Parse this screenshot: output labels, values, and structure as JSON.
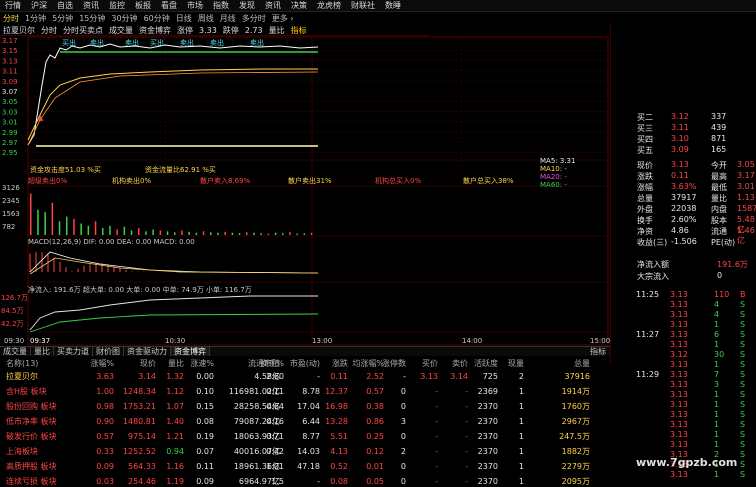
{
  "menu": [
    "行情",
    "沪深",
    "自选",
    "资讯",
    "监控",
    "板报",
    "看盘",
    "市场",
    "指数",
    "发现",
    "资讯",
    "决策",
    "龙虎榜",
    "财联社",
    "数睡"
  ],
  "periods": [
    {
      "label": "分时",
      "active": true
    },
    {
      "label": "1分钟"
    },
    {
      "label": "5分钟"
    },
    {
      "label": "15分钟"
    },
    {
      "label": "30分钟"
    },
    {
      "label": "60分钟"
    },
    {
      "label": "日线"
    },
    {
      "label": "周线"
    },
    {
      "label": "月线"
    },
    {
      "label": "多分时"
    },
    {
      "label": "更多 ›"
    }
  ],
  "toolbar": [
    "拉夏贝尔",
    "分时",
    "分时买卖点",
    "成交量",
    "资金博弈",
    "涨停",
    "3.33",
    "跌停",
    "2.73",
    "量比",
    "指标"
  ],
  "chart_labels": {
    "price_ticks": [
      "3.17",
      "3.15",
      "3.13",
      "3.11",
      "3.09",
      "3.07",
      "3.05",
      "3.03",
      "3.01",
      "2.99",
      "2.97",
      "2.95"
    ],
    "pct_ticks": [
      "1.92%",
      "1.27%",
      "0.63%",
      "0.63%",
      "1.27%",
      "1.92%",
      "2.56%",
      "3.21%",
      "3.85%",
      "4.49%",
      "5.13%",
      "5.77%"
    ],
    "buy_signals": [
      "买出",
      "卖出",
      "卖出",
      "买出",
      "卖出",
      "卖出",
      "卖出"
    ],
    "note1": "资金攻击度51.03 %买",
    "note2": "资金流量比62.91 %买",
    "ma5": "MA5: 3.31",
    "ma10": "MA10: -",
    "ma20": "MA20: -",
    "ma60": "MA60: -",
    "lot_row": [
      "超级卖出0%",
      "机构卖出0%",
      "散户卖入8.69%",
      "散户卖出31%",
      "机构总买入0%",
      "散户总买入38%"
    ],
    "vol_ticks": [
      "3126",
      "2345",
      "1563",
      "782"
    ],
    "macd_label": "MACD(12,26,9) DIF: 0.00  DEA: 0.00  MACD: 0.00",
    "macd_ticks": [
      "0.10",
      "0.05",
      "0.00",
      "-0.05",
      "-0.10"
    ],
    "flow_label": "净流入: 191.6万  超大单: 0.00  大单: 0.00  中单: 74.9万  小单: 116.7万",
    "flow_ticks": [
      "126.7万",
      "84.5万",
      "42.2万"
    ],
    "time_ticks": [
      "09:30",
      "09:37",
      "10:30",
      "13:00",
      "14:00",
      "15:00"
    ]
  },
  "quote": {
    "rows": [
      {
        "label": "买二",
        "price": "3.12",
        "vol": "337"
      },
      {
        "label": "买三",
        "price": "3.11",
        "vol": "439"
      },
      {
        "label": "买四",
        "price": "3.10",
        "vol": "871"
      },
      {
        "label": "买五",
        "price": "3.09",
        "vol": "165"
      },
      {
        "label": "现价",
        "price": "3.13",
        "vol": "今开",
        "extra": "3.05"
      },
      {
        "label": "涨跌",
        "price": "0.11",
        "vol": "最高",
        "extra": "3.17"
      },
      {
        "label": "涨幅",
        "price": "3.63%",
        "vol": "最低",
        "extra": "3.01"
      },
      {
        "label": "总量",
        "price": "37917",
        "vol": "量比",
        "extra": "1.13"
      },
      {
        "label": "外盘",
        "price": "22038",
        "vol": "内盘",
        "extra": "15879"
      },
      {
        "label": "换手",
        "price": "2.60%",
        "vol": "股本",
        "extra": "5.48亿"
      },
      {
        "label": "净资",
        "price": "4.86",
        "vol": "流通",
        "extra": "1.46亿"
      },
      {
        "label": "收益(三)",
        "price": "-1.506",
        "vol": "PE(动)",
        "extra": "-"
      }
    ],
    "netflow_label": "净流入额",
    "netflow_value": "191.6万",
    "bigflow_label": "大宗流入",
    "bigflow_value": "0"
  },
  "tabs": [
    "成交量",
    "量比",
    "买卖力道",
    "财价图",
    "资金驱动力",
    "资金博弈"
  ],
  "tabs_right": [
    "指标"
  ],
  "table": {
    "headers": [
      "名称(13)",
      "涨幅%",
      "现价",
      "量比",
      "涨速%",
      "流通市值",
      "换手%",
      "市盈(动)",
      "涨跌",
      "均涨幅%",
      "涨停数",
      "买价",
      "卖价",
      "活跃度",
      "现量",
      "总量"
    ],
    "rows": [
      [
        "拉夏贝尔",
        "3.63",
        "3.14",
        "1.32",
        "0.00",
        "4.58亿",
        "2.60",
        "-",
        "0.11",
        "2.52",
        "-",
        "3.13",
        "3.14",
        "725",
        "2",
        "37916"
      ],
      [
        "含H股 板块",
        "1.00",
        "1248.34",
        "1.12",
        "0.10",
        "116981.02亿",
        "0.11",
        "8.78",
        "12.37",
        "0.57",
        "0",
        "-",
        "-",
        "2369",
        "1",
        "1914万"
      ],
      [
        "股份回购 板块",
        "0.98",
        "1753.21",
        "1.07",
        "0.15",
        "28258.54亿",
        "0.64",
        "17.04",
        "16.98",
        "0.38",
        "0",
        "-",
        "-",
        "2370",
        "1",
        "1760万"
      ],
      [
        "低市净率 板块",
        "0.90",
        "1480.81",
        "1.40",
        "0.08",
        "79087.24亿",
        "0.16",
        "6.44",
        "13.28",
        "0.86",
        "3",
        "-",
        "-",
        "2370",
        "1",
        "2967万"
      ],
      [
        "破发行价 板块",
        "0.57",
        "975.14",
        "1.21",
        "0.19",
        "18063.93亿",
        "0.71",
        "8.77",
        "5.51",
        "0.25",
        "0",
        "-",
        "-",
        "2370",
        "1",
        "247.5万"
      ],
      [
        "上海板块",
        "0.33",
        "1252.52",
        "0.94",
        "0.07",
        "40016.07亿",
        "0.42",
        "14.03",
        "4.13",
        "0.12",
        "2",
        "-",
        "-",
        "2370",
        "1",
        "1882万"
      ],
      [
        "高质押股 板块",
        "0.09",
        "564.33",
        "1.16",
        "0.11",
        "18961.36亿",
        "1.01",
        "47.18",
        "0.52",
        "0.01",
        "0",
        "-",
        "-",
        "2370",
        "1",
        "2279万"
      ],
      [
        "连续亏损 板块",
        "0.03",
        "254.46",
        "1.19",
        "0.09",
        "6964.97亿",
        "1.5",
        "-",
        "0.08",
        "0.05",
        "0",
        "-",
        "-",
        "2370",
        "1",
        "2095万"
      ]
    ]
  },
  "ticks": [
    [
      "11:25",
      "3.13",
      "110",
      "B"
    ],
    [
      "",
      "3.13",
      "4",
      "S"
    ],
    [
      "",
      "3.13",
      "4",
      "S"
    ],
    [
      "",
      "3.13",
      "1",
      "S"
    ],
    [
      "11:27",
      "3.13",
      "6",
      "S"
    ],
    [
      "",
      "3.13",
      "1",
      "S"
    ],
    [
      "",
      "3.12",
      "30",
      "S"
    ],
    [
      "",
      "3.13",
      "1",
      "S"
    ],
    [
      "11:29",
      "3.13",
      "7",
      "S"
    ],
    [
      "",
      "3.13",
      "3",
      "S"
    ],
    [
      "",
      "3.13",
      "1",
      "S"
    ],
    [
      "",
      "3.13",
      "1",
      "S"
    ],
    [
      "",
      "3.13",
      "1",
      "S"
    ],
    [
      "",
      "3.13",
      "1",
      "S"
    ],
    [
      "",
      "3.13",
      "1",
      "S"
    ],
    [
      "",
      "3.13",
      "1",
      "S"
    ],
    [
      "",
      "3.13",
      "2",
      "S"
    ],
    [
      "",
      "3.13",
      "1",
      "S"
    ],
    [
      "",
      "3.13",
      "1",
      "S"
    ]
  ],
  "watermark": "www.7gpzb.com",
  "colors": {
    "up": "#ff4444",
    "down": "#36d24a",
    "price": "#ffffff",
    "avg": "#ffd24a",
    "grid": "#5a0000"
  }
}
